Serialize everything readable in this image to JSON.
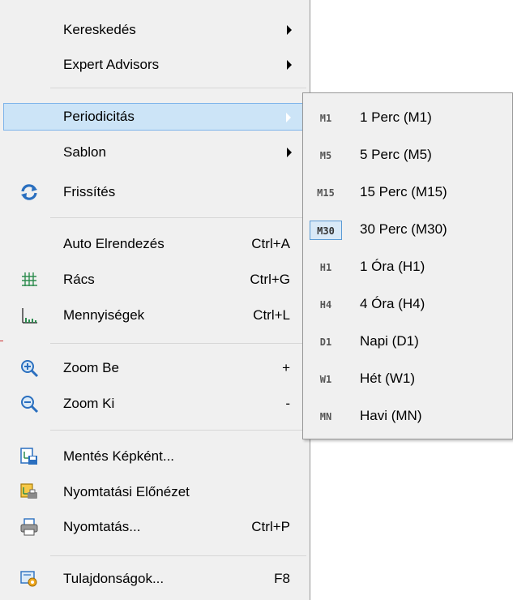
{
  "menu": {
    "items": [
      {
        "label": "Kereskedés",
        "submenu": true
      },
      {
        "label": "Expert Advisors",
        "submenu": true
      },
      {
        "label": "Periodicitás",
        "submenu": true,
        "highlighted": true
      },
      {
        "label": "Sablon",
        "submenu": true
      },
      {
        "label": "Frissítés",
        "icon": "refresh-icon"
      },
      {
        "label": "Auto Elrendezés",
        "shortcut": "Ctrl+A"
      },
      {
        "label": "Rács",
        "shortcut": "Ctrl+G",
        "icon": "grid-icon"
      },
      {
        "label": "Mennyiségek",
        "shortcut": "Ctrl+L",
        "icon": "volumes-icon"
      },
      {
        "label": "Zoom Be",
        "shortcut": "+",
        "icon": "zoom-in-icon"
      },
      {
        "label": "Zoom Ki",
        "shortcut": "-",
        "icon": "zoom-out-icon"
      },
      {
        "label": "Mentés Képként...",
        "icon": "save-image-icon"
      },
      {
        "label": "Nyomtatási Előnézet",
        "icon": "print-preview-icon"
      },
      {
        "label": "Nyomtatás...",
        "shortcut": "Ctrl+P",
        "icon": "printer-icon"
      },
      {
        "label": "Tulajdonságok...",
        "shortcut": "F8",
        "icon": "properties-icon"
      }
    ]
  },
  "submenu": {
    "items": [
      {
        "code": "M1",
        "label": "1 Perc (M1)"
      },
      {
        "code": "M5",
        "label": "5 Perc (M5)"
      },
      {
        "code": "M15",
        "label": "15 Perc (M15)"
      },
      {
        "code": "M30",
        "label": "30 Perc (M30)",
        "selected": true
      },
      {
        "code": "H1",
        "label": "1 Óra (H1)"
      },
      {
        "code": "H4",
        "label": "4 Óra (H4)"
      },
      {
        "code": "D1",
        "label": "Napi (D1)"
      },
      {
        "code": "W1",
        "label": "Hét (W1)"
      },
      {
        "code": "MN",
        "label": "Havi (MN)"
      }
    ]
  },
  "colors": {
    "highlight_bg": "#cce4f7",
    "highlight_border": "#7eb4ea",
    "menu_bg": "#f0f0f0",
    "icon_blue": "#2a6fbf"
  }
}
